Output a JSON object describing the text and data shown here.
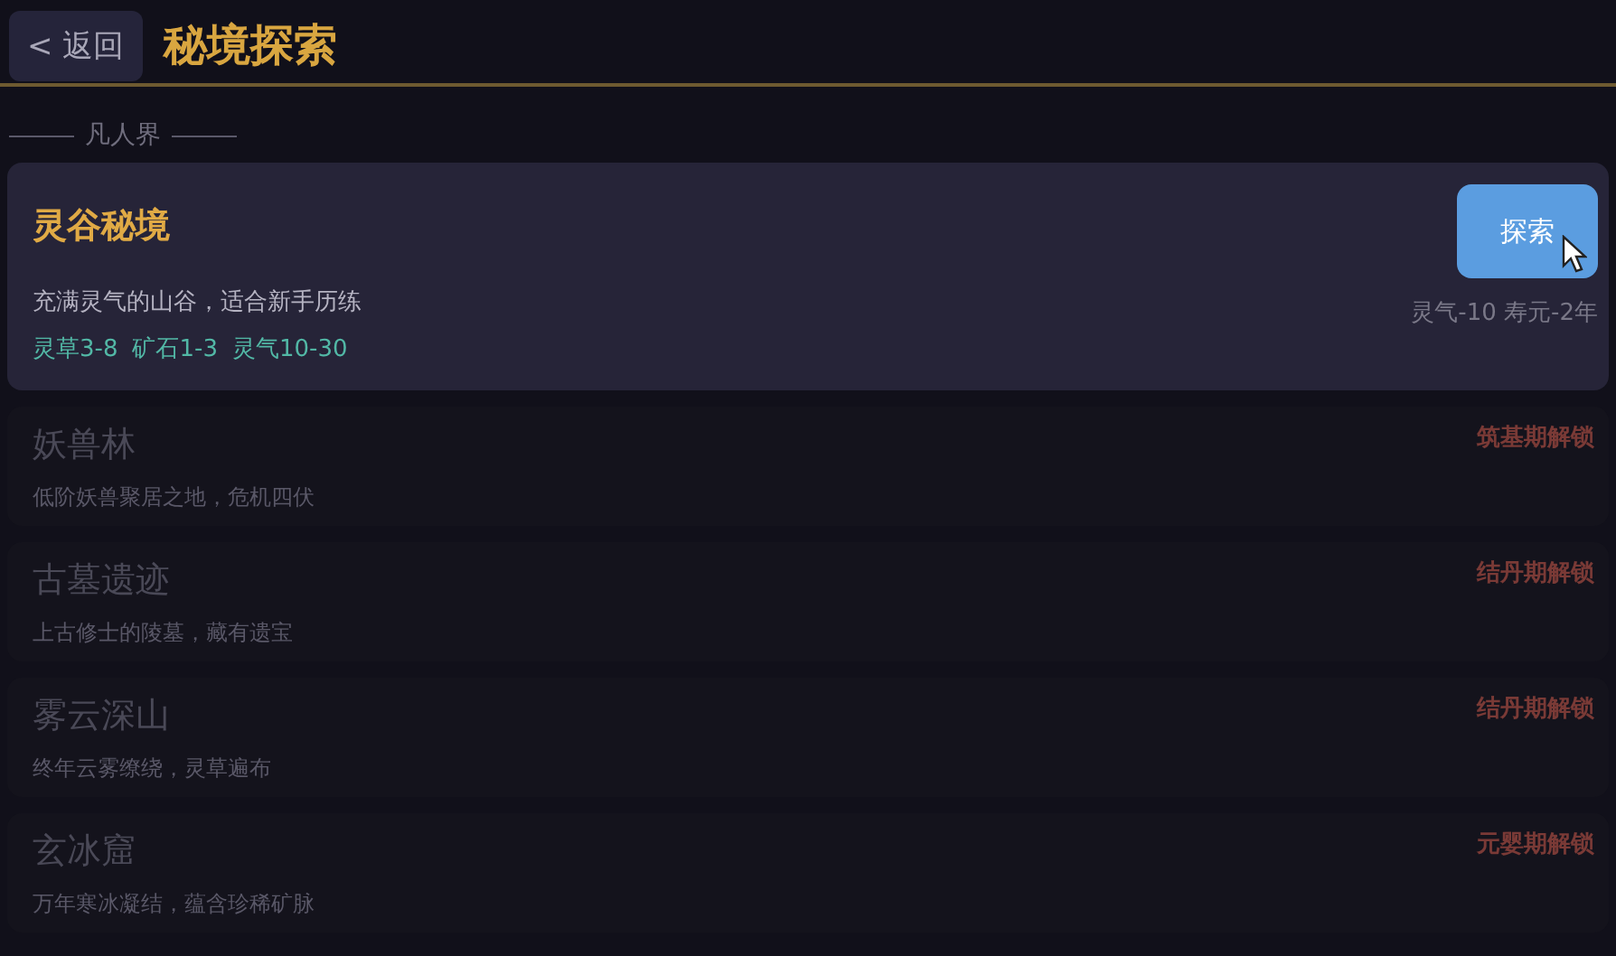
{
  "header": {
    "back_button": "< 返回",
    "title": "秘境探索"
  },
  "section": {
    "label": "凡人界"
  },
  "realms": [
    {
      "name": "灵谷秘境",
      "description": "充满灵气的山谷，适合新手历练",
      "rewards": [
        "灵草3-8",
        "矿石1-3",
        "灵气10-30"
      ],
      "button": "探索",
      "cost": "灵气-10 寿元-2年",
      "locked": false
    },
    {
      "name": "妖兽林",
      "description": "低阶妖兽聚居之地，危机四伏",
      "lock_text": "筑基期解锁",
      "locked": true
    },
    {
      "name": "古墓遗迹",
      "description": "上古修士的陵墓，藏有遗宝",
      "lock_text": "结丹期解锁",
      "locked": true
    },
    {
      "name": "雾云深山",
      "description": "终年云雾缭绕，灵草遍布",
      "lock_text": "结丹期解锁",
      "locked": true
    },
    {
      "name": "玄冰窟",
      "description": "万年寒冰凝结，蕴含珍稀矿脉",
      "lock_text": "元婴期解锁",
      "locked": true
    }
  ]
}
